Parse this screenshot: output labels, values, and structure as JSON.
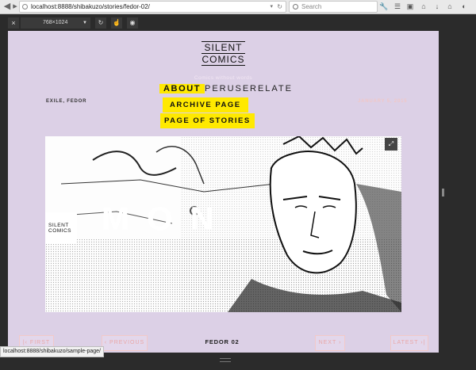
{
  "browser": {
    "url": "localhost:8888/shibakuzo/stories/fedor-02/",
    "search_placeholder": "Search",
    "icons": [
      "back-icon",
      "forward-icon",
      "globe-icon",
      "reload-icon",
      "search-icon",
      "tools-icon",
      "reader-icon",
      "home-icon",
      "download-icon",
      "menu-icon"
    ]
  },
  "responsive_toolbar": {
    "close_label": "×",
    "size_value": "768×1024",
    "rotate_label": "↻",
    "touch_label": "☝",
    "screenshot_label": "◉"
  },
  "site": {
    "logo_line1": "SILENT",
    "logo_line2": "COMICS",
    "tagline": "Comics without words",
    "menu": {
      "about": "ABOUT",
      "peruse": "PERUSE",
      "relate": "RELATE",
      "archive_page": "ARCHIVE PAGE",
      "page_of_stories": "PAGE OF STORIES"
    },
    "meta_left": "EXILE, FEDOR",
    "meta_right": "JANUARY 5, 2015",
    "hero_title": "MON",
    "mini_logo_1": "SILENT",
    "mini_logo_2": "COMICS",
    "pagination": {
      "first": "|‹ FIRST",
      "previous": "‹ PREVIOUS",
      "current": "FEDOR 02",
      "next": "NEXT ›",
      "latest": "LATEST ›|"
    }
  },
  "status_bar": "localhost:8888/shibakuzo/sample-page/",
  "colors": {
    "page_bg": "#dcd0e6",
    "highlight": "#ffe900",
    "pager_text": "#e9a7a7"
  }
}
